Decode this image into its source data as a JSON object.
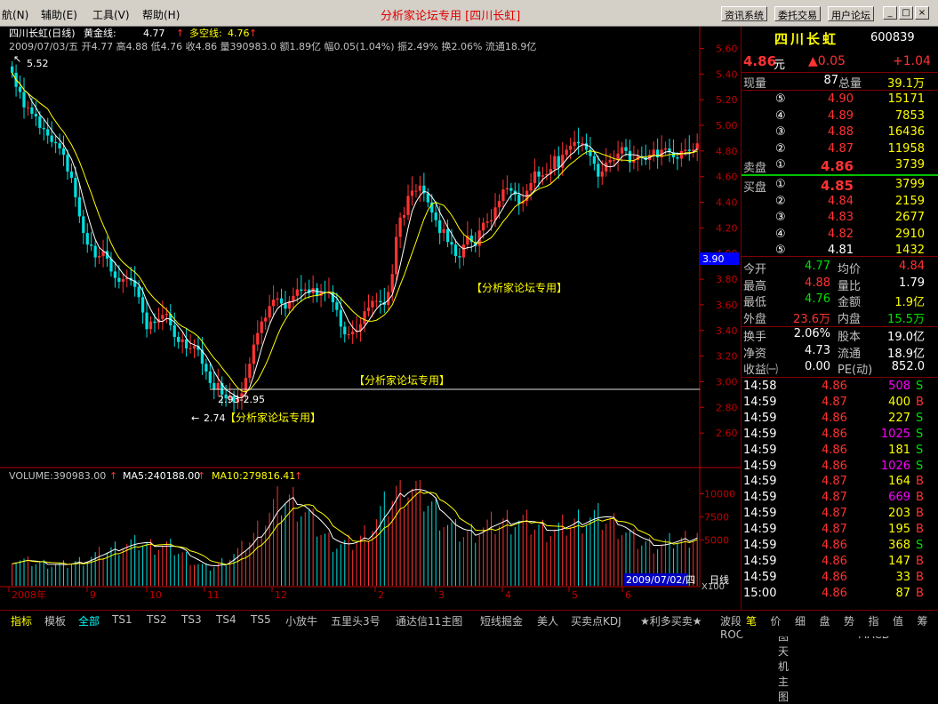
{
  "menu": {
    "items": [
      "航(N)",
      "辅助(E)",
      "工具(V)",
      "帮助(H)"
    ]
  },
  "window_title": "分析家论坛专用 [四川长虹]",
  "top_buttons": [
    "资讯系统",
    "委托交易",
    "用户论坛"
  ],
  "window_controls": [
    "_",
    "□",
    "×"
  ],
  "chart_header": {
    "name": "四川长虹(日线)",
    "indicators": [
      {
        "label": "黄金线:",
        "value": "4.77"
      },
      {
        "label": "多空线:",
        "value": "4.76"
      }
    ],
    "ohlc_line": "2009/07/03/五 开4.77 高4.88 低4.76 收4.86 量390983.0 额1.89亿 幅0.05(1.04%) 振2.49% 换2.06% 流通18.9亿"
  },
  "annotations": {
    "high_label": "5.52",
    "low_label": "2.74",
    "range_label": "2.93-2.95",
    "watermark": "【分析家论坛专用】",
    "price_marker": "3.90",
    "unit_label": "X100",
    "date_label": "2009/07/02/四",
    "period_label": "日线"
  },
  "volume_header": {
    "vol": "VOLUME:390983.00",
    "ma5": "MA5:240188.00",
    "ma10": "MA10:279816.41"
  },
  "colors": {
    "up": "#ff3232",
    "down": "#00e0e0",
    "ma_white": "#ffffff",
    "ma_yellow": "#ffff00",
    "grid": "#800000",
    "axis": "#c00000"
  },
  "chart_data": [
    {
      "type": "candlestick",
      "title": "四川长虹(日线)",
      "x_axis_ticks": [
        "2008年",
        "9",
        "10",
        "11",
        "12",
        "2",
        "3",
        "4",
        "5",
        "6"
      ],
      "y_ticks": [
        2.6,
        2.8,
        3.0,
        3.2,
        3.4,
        3.6,
        3.8,
        4.0,
        4.2,
        4.4,
        4.6,
        4.8,
        5.0,
        5.2,
        5.4,
        5.6
      ],
      "ylim": [
        2.4,
        5.7
      ],
      "close": [
        5.41,
        5.3,
        5.26,
        5.14,
        5.14,
        5.09,
        5.07,
        4.98,
        4.97,
        4.92,
        4.87,
        4.86,
        4.82,
        4.77,
        4.64,
        4.59,
        4.44,
        4.29,
        4.16,
        4.07,
        4.06,
        3.97,
        3.98,
        4.02,
        3.96,
        3.86,
        3.81,
        3.78,
        3.8,
        3.81,
        3.79,
        3.74,
        3.66,
        3.54,
        3.41,
        3.47,
        3.46,
        3.49,
        3.52,
        3.53,
        3.44,
        3.35,
        3.31,
        3.33,
        3.26,
        3.26,
        3.28,
        3.25,
        3.14,
        3.08,
        2.99,
        2.94,
        2.99,
        2.9,
        2.87,
        2.89,
        2.84,
        2.87,
        2.91,
        3.03,
        3.14,
        3.29,
        3.38,
        3.47,
        3.5,
        3.59,
        3.64,
        3.65,
        3.61,
        3.57,
        3.63,
        3.67,
        3.72,
        3.71,
        3.72,
        3.69,
        3.73,
        3.67,
        3.7,
        3.69,
        3.7,
        3.62,
        3.56,
        3.43,
        3.37,
        3.37,
        3.39,
        3.4,
        3.45,
        3.55,
        3.58,
        3.63,
        3.63,
        3.62,
        3.6,
        3.7,
        3.84,
        4.13,
        4.28,
        4.3,
        4.45,
        4.49,
        4.49,
        4.53,
        4.47,
        4.4,
        4.32,
        4.26,
        4.16,
        4.19,
        4.09,
        4.07,
        3.98,
        3.97,
        4.07,
        4.14,
        4.09,
        4.06,
        4.18,
        4.24,
        4.25,
        4.26,
        4.36,
        4.41,
        4.5,
        4.51,
        4.49,
        4.46,
        4.39,
        4.41,
        4.49,
        4.55,
        4.64,
        4.6,
        4.61,
        4.62,
        4.66,
        4.76,
        4.67,
        4.77,
        4.81,
        4.84,
        4.87,
        4.86,
        4.86,
        4.81,
        4.76,
        4.7,
        4.6,
        4.64,
        4.71,
        4.73,
        4.73,
        4.78,
        4.83,
        4.8,
        4.71,
        4.73,
        4.76,
        4.75,
        4.73,
        4.77,
        4.81,
        4.75,
        4.81,
        4.82,
        4.79,
        4.75,
        4.74,
        4.8,
        4.81,
        4.8,
        4.81,
        4.86
      ],
      "high": 5.52,
      "low": 2.74
    },
    {
      "type": "bar",
      "title": "VOLUME",
      "unit": "X100",
      "y_ticks": [
        5000,
        7500,
        10000
      ],
      "ylim": [
        0,
        11500
      ],
      "values": [
        2082,
        1945,
        1877,
        1815,
        1778,
        1744,
        1690,
        1653,
        1651,
        1613,
        1567,
        1570,
        1560,
        1542,
        1586,
        1660,
        1745,
        1825,
        1914,
        1988,
        2142,
        2246,
        2369,
        2470,
        2599,
        2707,
        2813,
        2917,
        3066,
        3104,
        3088,
        3081,
        3133,
        3096,
        3077,
        2968,
        2950,
        2958,
        2959,
        2970,
        2869,
        2694,
        2500,
        2350,
        2147,
        1962,
        1736,
        1599,
        1460,
        1366,
        1347,
        1449,
        1563,
        1755,
        1990,
        2163,
        2345,
        2514,
        2736,
        3034,
        3397,
        3713,
        4140,
        4580,
        4986,
        5401,
        5777,
        6042,
        6219,
        6399,
        6406,
        6282,
        6076,
        5770,
        5439,
        5038,
        4683,
        4344,
        3977,
        3653,
        3384,
        3209,
        3082,
        3066,
        3057,
        3100,
        3168,
        3305,
        3518,
        3854,
        4173,
        4553,
        4922,
        5325,
        5735,
        6166,
        6637,
        7008,
        7235,
        7323,
        7340,
        7183,
        6996,
        6832,
        6568,
        6253,
        5914,
        5594,
        5230,
        4865,
        4492,
        4243,
        4053,
        3907,
        3811,
        3846,
        3925,
        4064,
        4208,
        4314,
        4416,
        4505,
        4553,
        4657,
        4740,
        4826,
        4861,
        4867,
        4818,
        4734,
        4624,
        4529,
        4405,
        4296,
        4194,
        4120,
        4124,
        4155,
        4222,
        4321,
        4435,
        4576,
        4706,
        4842,
        4946,
        4995,
        5056,
        5053,
        5020,
        4948,
        4853,
        4762,
        4625,
        4439,
        4203,
        3938,
        3671,
        3443,
        3255,
        3152,
        3113,
        3090,
        3055,
        3024,
        3042,
        3105,
        3206,
        3299,
        3367,
        3393,
        3499,
        3611,
        3728,
        3910
      ]
    }
  ],
  "quote": {
    "name": "四川长虹",
    "code": "600839",
    "price": "4.86",
    "unit": "元",
    "change": "▲0.05",
    "change_pct": "+1.04",
    "cur_vol_label": "现量",
    "cur_vol": "87",
    "total_vol_label": "总量",
    "total_vol": "39.1万",
    "sell": [
      {
        "lv": "⑤",
        "price": "4.90",
        "vol": "15171"
      },
      {
        "lv": "④",
        "price": "4.89",
        "vol": "7853"
      },
      {
        "lv": "③",
        "price": "4.88",
        "vol": "16436"
      },
      {
        "lv": "②",
        "price": "4.87",
        "vol": "11958"
      },
      {
        "lv": "①",
        "price": "4.86",
        "vol": "3739"
      }
    ],
    "sell_label": "卖盘",
    "buy_label": "买盘",
    "buy": [
      {
        "lv": "①",
        "price": "4.85",
        "vol": "3799"
      },
      {
        "lv": "②",
        "price": "4.84",
        "vol": "2159"
      },
      {
        "lv": "③",
        "price": "4.83",
        "vol": "2677"
      },
      {
        "lv": "④",
        "price": "4.82",
        "vol": "2910"
      },
      {
        "lv": "⑤",
        "price": "4.81",
        "vol": "1432"
      }
    ],
    "stats": [
      {
        "l1": "今开",
        "v1": "4.77",
        "c1": "grn",
        "l2": "均价",
        "v2": "4.84",
        "c2": "red"
      },
      {
        "l1": "最高",
        "v1": "4.88",
        "c1": "red",
        "l2": "量比",
        "v2": "1.79",
        "c2": "wht"
      },
      {
        "l1": "最低",
        "v1": "4.76",
        "c1": "grn",
        "l2": "金额",
        "v2": "1.9亿",
        "c2": "yel"
      },
      {
        "l1": "外盘",
        "v1": "23.6万",
        "c1": "red",
        "l2": "内盘",
        "v2": "15.5万",
        "c2": "grn"
      },
      {
        "l1": "换手",
        "v1": "2.06%",
        "c1": "wht",
        "l2": "股本",
        "v2": "19.0亿",
        "c2": "wht"
      },
      {
        "l1": "净资",
        "v1": "4.73",
        "c1": "wht",
        "l2": "流通",
        "v2": "18.9亿",
        "c2": "wht"
      },
      {
        "l1": "收益㈠",
        "v1": "0.00",
        "c1": "wht",
        "l2": "PE(动)",
        "v2": "852.0",
        "c2": "wht"
      }
    ],
    "ticks": [
      {
        "t": "14:58",
        "p": "4.86",
        "v": "508",
        "s": "S"
      },
      {
        "t": "14:59",
        "p": "4.87",
        "v": "400",
        "s": "B"
      },
      {
        "t": "14:59",
        "p": "4.86",
        "v": "227",
        "s": "S"
      },
      {
        "t": "14:59",
        "p": "4.86",
        "v": "1025",
        "s": "S"
      },
      {
        "t": "14:59",
        "p": "4.86",
        "v": "181",
        "s": "S"
      },
      {
        "t": "14:59",
        "p": "4.86",
        "v": "1026",
        "s": "S"
      },
      {
        "t": "14:59",
        "p": "4.87",
        "v": "164",
        "s": "B"
      },
      {
        "t": "14:59",
        "p": "4.87",
        "v": "669",
        "s": "B"
      },
      {
        "t": "14:59",
        "p": "4.87",
        "v": "203",
        "s": "B"
      },
      {
        "t": "14:59",
        "p": "4.87",
        "v": "195",
        "s": "B"
      },
      {
        "t": "14:59",
        "p": "4.86",
        "v": "368",
        "s": "S"
      },
      {
        "t": "14:59",
        "p": "4.86",
        "v": "147",
        "s": "B"
      },
      {
        "t": "14:59",
        "p": "4.86",
        "v": "33",
        "s": "B"
      },
      {
        "t": "15:00",
        "p": "4.86",
        "v": "87",
        "s": "B"
      }
    ]
  },
  "bottom_tabs": [
    "指标",
    "模板",
    "全部",
    "TS1",
    "TS2",
    "TS3",
    "TS4",
    "TS5",
    "小放牛",
    "五里头3号",
    "通达信11主图",
    "短线掘金",
    "美人",
    "买卖点KDJ",
    "★利多买卖★",
    "波段ROC",
    "主图天机主图",
    "线MACD"
  ],
  "right_tabs": [
    "笔",
    "价",
    "细",
    "盘",
    "势",
    "指",
    "值",
    "筹"
  ]
}
